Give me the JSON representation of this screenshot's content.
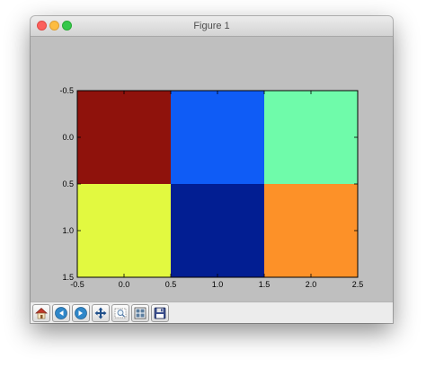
{
  "window": {
    "title": "Figure 1"
  },
  "toolbar": {
    "buttons": [
      {
        "name": "home-button",
        "icon": "home-icon"
      },
      {
        "name": "back-button",
        "icon": "back-arrow-icon"
      },
      {
        "name": "forward-button",
        "icon": "forward-arrow-icon"
      },
      {
        "name": "pan-button",
        "icon": "pan-move-icon"
      },
      {
        "name": "zoom-button",
        "icon": "zoom-rect-icon"
      },
      {
        "name": "subplots-button",
        "icon": "subplots-config-icon"
      },
      {
        "name": "save-button",
        "icon": "save-floppy-icon"
      }
    ]
  },
  "chart_data": {
    "type": "heatmap",
    "title": "",
    "xlabel": "",
    "ylabel": "",
    "grid": false,
    "xlim": [
      -0.5,
      2.5
    ],
    "ylim": [
      1.5,
      -0.5
    ],
    "x_ticks": [
      "-0.5",
      "0.0",
      "0.5",
      "1.0",
      "1.5",
      "2.0",
      "2.5"
    ],
    "y_ticks": [
      "-0.5",
      "0.0",
      "0.5",
      "1.0",
      "1.5"
    ],
    "cells": [
      [
        "#8f120c",
        "#0f5cf6",
        "#6ffbaa"
      ],
      [
        "#e2f940",
        "#021e92",
        "#fd9128"
      ]
    ]
  }
}
